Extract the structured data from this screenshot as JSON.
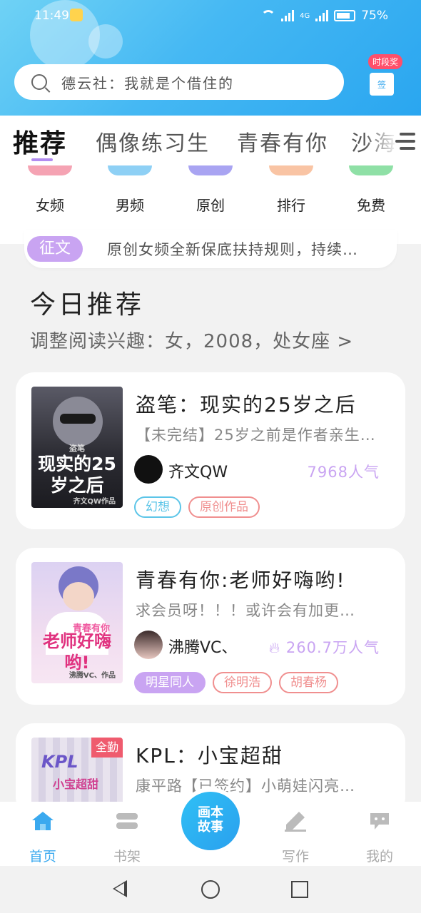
{
  "status_bar": {
    "time": "11:49",
    "network": "4G",
    "battery": "75%"
  },
  "search": {
    "placeholder": "德云社：我就是个借住的"
  },
  "gift": {
    "badge": "时段奖",
    "label": "签"
  },
  "tabs": [
    {
      "label": "推荐",
      "active": true
    },
    {
      "label": "偶像练习生",
      "active": false
    },
    {
      "label": "青春有你",
      "active": false
    },
    {
      "label": "沙海",
      "active": false
    }
  ],
  "categories": [
    {
      "label": "女频",
      "color": "#f5a3b3"
    },
    {
      "label": "男频",
      "color": "#8ed0f5"
    },
    {
      "label": "原创",
      "color": "#a9a4f2"
    },
    {
      "label": "排行",
      "color": "#f9c4a4"
    },
    {
      "label": "免费",
      "color": "#8fe0a6"
    }
  ],
  "notice": {
    "tag": "征文",
    "text": "原创女频全新保底扶持规则，持续…"
  },
  "section": {
    "title": "今日推荐",
    "subtitle": "调整阅读兴趣：女，2008，处女座 >"
  },
  "books": [
    {
      "title": "盗笔：现实的25岁之后",
      "desc": "【未完结】25岁之前是作者亲生…",
      "author": "齐文QW",
      "popularity": "7968人气",
      "hot": false,
      "cover_text": "现实的25岁之后",
      "cover_top": "盗笔",
      "cover_author": "齐文QW作品",
      "tags": [
        {
          "label": "幻想",
          "color": "#5cc5e8"
        },
        {
          "label": "原创作品",
          "color": "#f08f8f"
        }
      ]
    },
    {
      "title": "青春有你:老师好嗨哟!",
      "desc": "求会员呀！！！或许会有加更…",
      "author": "沸腾VC、",
      "popularity": "260.7万人气",
      "hot": true,
      "cover_text": "老师好嗨哟!",
      "cover_top": "青春有你",
      "cover_author": "沸腾VC、作品",
      "tags": [
        {
          "label": "明星同人",
          "color": "#c9a4f2",
          "filled": true
        },
        {
          "label": "徐明浩",
          "color": "#f08f8f"
        },
        {
          "label": "胡春杨",
          "color": "#f08f8f"
        }
      ]
    },
    {
      "title": "KPL：小宝超甜",
      "desc": "康平路【已签约】小萌娃闪亮…",
      "badge": "全勤",
      "cover_text": "KPL",
      "cover_sub": "小宝超甜"
    }
  ],
  "bottom_nav": [
    {
      "label": "首页",
      "active": true
    },
    {
      "label": "书架",
      "active": false
    },
    {
      "label": "画本故事",
      "center": true
    },
    {
      "label": "写作",
      "active": false
    },
    {
      "label": "我的",
      "active": false
    }
  ]
}
